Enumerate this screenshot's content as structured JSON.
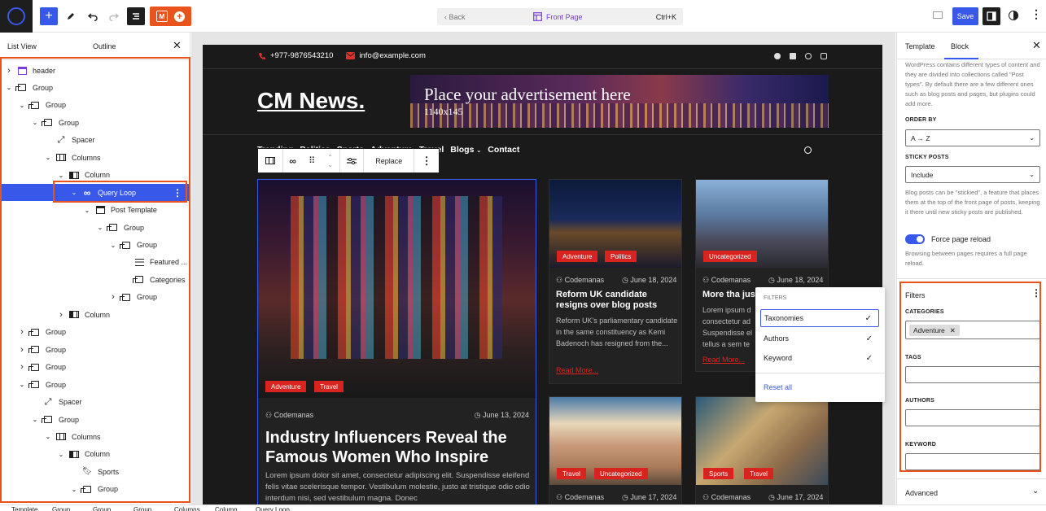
{
  "topbar": {
    "back_label": "Back",
    "page_title": "Front Page",
    "shortcut": "Ctrl+K",
    "save_label": "Save"
  },
  "left_panel": {
    "tab_list_view": "List View",
    "tab_outline": "Outline",
    "tree": [
      {
        "label": "header",
        "icon": "template-part-icon",
        "depth": 0,
        "chevron": "right"
      },
      {
        "label": "Group",
        "icon": "group-icon",
        "depth": 0,
        "chevron": "down"
      },
      {
        "label": "Group",
        "icon": "group-icon",
        "depth": 1,
        "chevron": "down"
      },
      {
        "label": "Group",
        "icon": "group-icon",
        "depth": 2,
        "chevron": "down"
      },
      {
        "label": "Spacer",
        "icon": "spacer-icon",
        "depth": 3,
        "chevron": ""
      },
      {
        "label": "Columns",
        "icon": "columns-icon",
        "depth": 3,
        "chevron": "down"
      },
      {
        "label": "Column",
        "icon": "column-icon",
        "depth": 4,
        "chevron": "down"
      },
      {
        "label": "Query Loop",
        "icon": "loop-icon",
        "depth": 5,
        "chevron": "down",
        "selected": true
      },
      {
        "label": "Post Template",
        "icon": "template-icon",
        "depth": 6,
        "chevron": "down"
      },
      {
        "label": "Group",
        "icon": "group-icon",
        "depth": 7,
        "chevron": "down"
      },
      {
        "label": "Group",
        "icon": "group-icon",
        "depth": 8,
        "chevron": "down"
      },
      {
        "label": "Featured ...",
        "icon": "featured-image-icon",
        "depth": 9,
        "chevron": ""
      },
      {
        "label": "Categories",
        "icon": "categories-icon",
        "depth": 9,
        "chevron": ""
      },
      {
        "label": "Group",
        "icon": "group-icon",
        "depth": 8,
        "chevron": "right"
      },
      {
        "label": "Column",
        "icon": "column-icon",
        "depth": 4,
        "chevron": "right"
      },
      {
        "label": "Group",
        "icon": "group-icon",
        "depth": 1,
        "chevron": "right"
      },
      {
        "label": "Group",
        "icon": "group-icon",
        "depth": 1,
        "chevron": "right"
      },
      {
        "label": "Group",
        "icon": "group-icon",
        "depth": 1,
        "chevron": "right"
      },
      {
        "label": "Group",
        "icon": "group-icon",
        "depth": 1,
        "chevron": "down"
      },
      {
        "label": "Spacer",
        "icon": "spacer-icon",
        "depth": 2,
        "chevron": ""
      },
      {
        "label": "Group",
        "icon": "group-icon",
        "depth": 2,
        "chevron": "down"
      },
      {
        "label": "Columns",
        "icon": "columns-icon",
        "depth": 3,
        "chevron": "down"
      },
      {
        "label": "Column",
        "icon": "column-icon",
        "depth": 4,
        "chevron": "down"
      },
      {
        "label": "Sports",
        "icon": "bookmark-icon",
        "depth": 5,
        "chevron": ""
      },
      {
        "label": "Group",
        "icon": "group-icon",
        "depth": 5,
        "chevron": "down"
      }
    ]
  },
  "site": {
    "phone": "+977-9876543210",
    "email": "info@example.com",
    "site_title": "CM News.",
    "ad_line1": "Place your advertisement here",
    "ad_line2": "1140x145",
    "nav": [
      "Trending",
      "Politics",
      "Sports",
      "Adventure",
      "Travel",
      "Blogs",
      "Contact"
    ],
    "block_toolbar_replace": "Replace",
    "featured": {
      "tags": [
        "Adventure",
        "Travel"
      ],
      "author": "Codemanas",
      "date": "June 13, 2024",
      "title": "Industry Influencers Reveal the Famous Women Who Inspire",
      "excerpt": "Lorem ipsum dolor sit amet, consectetur adipiscing elit. Suspendisse eleifend felis vitae scelerisque tempor. Vestibulum molestie, justo at tristique odio odio interdum nisi, sed vestibulum magna. Donec"
    },
    "card1": {
      "tags": [
        "Adventure",
        "Politics"
      ],
      "author": "Codemanas",
      "date": "June 18, 2024",
      "title": "Reform UK candidate resigns over blog posts",
      "excerpt": "Reform UK's parliamentary candidate in the same constituency as Kemi Badenoch has resigned from the...",
      "read_more": "Read More..."
    },
    "card2": {
      "tags": [
        "Uncategorized"
      ],
      "author": "Codemanas",
      "date": "June 18, 2024",
      "title": "More tha just",
      "excerpt": "Lorem ipsum d consectetur ad Suspendisse el tellus a sem te",
      "read_more": "Read More..."
    },
    "card3": {
      "tags": [
        "Travel",
        "Uncategorized"
      ],
      "author": "Codemanas",
      "date": "June 17, 2024"
    },
    "card4": {
      "tags": [
        "Sports",
        "Travel"
      ],
      "author": "Codemanas",
      "date": "June 17, 2024"
    }
  },
  "popover": {
    "heading": "FILTERS",
    "items": [
      {
        "label": "Taxonomies",
        "checked": true
      },
      {
        "label": "Authors",
        "checked": true
      },
      {
        "label": "Keyword",
        "checked": true
      }
    ],
    "reset": "Reset all"
  },
  "right_panel": {
    "tab_template": "Template",
    "tab_block": "Block",
    "intro": "WordPress contains different types of content and they are divided into collections called \"Post types\". By default there are a few different ones such as blog posts and pages, but plugins could add more.",
    "order_by_label": "ORDER BY",
    "order_by_value": "A → Z",
    "sticky_label": "STICKY POSTS",
    "sticky_value": "Include",
    "sticky_help": "Blog posts can be \"stickied\", a feature that places them at the top of the front page of posts, keeping it there until new sticky posts are published.",
    "force_reload_label": "Force page reload",
    "force_reload_help": "Browsing between pages requires a full page reload.",
    "filters_title": "Filters",
    "categories_label": "CATEGORIES",
    "category_token": "Adventure",
    "tags_label": "TAGS",
    "authors_label": "AUTHORS",
    "keyword_label": "KEYWORD",
    "advanced_label": "Advanced"
  },
  "breadcrumbs": [
    "Template",
    "Group",
    "Group",
    "Group",
    "Columns",
    "Column",
    "Query Loop"
  ],
  "colors": {
    "accent": "#3858e9",
    "highlight": "#e8541b",
    "tag_red": "#d9231f",
    "site_bg": "#1a1a1a"
  }
}
